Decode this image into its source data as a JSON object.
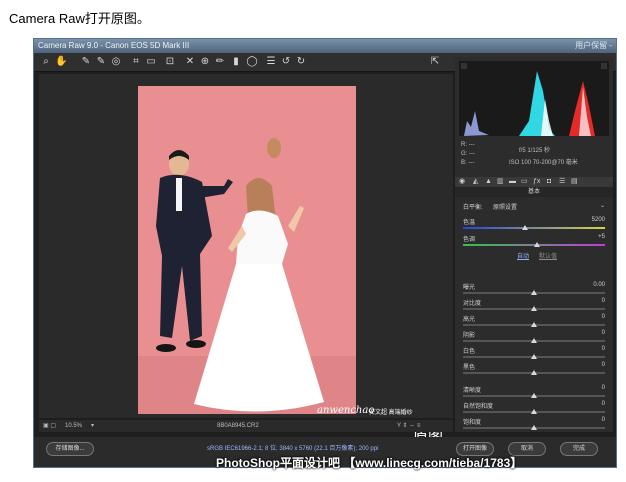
{
  "caption": "Camera Raw打开原图。",
  "window": {
    "title": "Camera Raw 9.0 - Canon EOS 5D Mark III",
    "title_right": "用户保留 -"
  },
  "toolbar": {
    "icons": [
      "zoom-icon",
      "hand-icon",
      "white-balance-icon",
      "color-sampler-icon",
      "target-adjust-icon",
      "crop-icon",
      "straighten-icon",
      "transform-icon",
      "spot-removal-icon",
      "red-eye-icon",
      "adjust-brush-icon",
      "graduated-filter-icon",
      "radial-filter-icon",
      "preferences-icon",
      "rotate-ccw-icon",
      "rotate-cw-icon",
      "fullscreen-icon"
    ]
  },
  "photo": {
    "watermark_script": "anwenchao",
    "watermark_cn": "安文超 高端婚纱",
    "watermark_label": "原图"
  },
  "bottombar": {
    "zoom": "10.5%",
    "filename": "8B0A8945.CR2"
  },
  "camera": {
    "r": "R: ---",
    "g": "G: ---",
    "b": "B: ---",
    "aperture": "f/5",
    "shutter": "1/125 秒",
    "iso": "ISO 100",
    "focal": "70-200@70 毫米"
  },
  "panel": {
    "title": "基本",
    "wb_label": "白平衡:",
    "wb_value": "原照设置",
    "temp": {
      "label": "色温",
      "value": "5200",
      "level": 0.44
    },
    "tint": {
      "label": "色调",
      "value": "+5",
      "level": 0.52
    },
    "auto": "自动",
    "default": "默认值",
    "sliders": [
      {
        "label": "曝光",
        "value": "0.00",
        "level": 0.5
      },
      {
        "label": "对比度",
        "value": "0",
        "level": 0.5
      },
      {
        "label": "高光",
        "value": "0",
        "level": 0.5
      },
      {
        "label": "阴影",
        "value": "0",
        "level": 0.5
      },
      {
        "label": "白色",
        "value": "0",
        "level": 0.5
      },
      {
        "label": "黑色",
        "value": "0",
        "level": 0.5
      },
      {
        "label": "清晰度",
        "value": "0",
        "level": 0.5
      },
      {
        "label": "自然饱和度",
        "value": "0",
        "level": 0.5
      },
      {
        "label": "饱和度",
        "value": "0",
        "level": 0.5
      }
    ]
  },
  "footer": {
    "save": "存储图像...",
    "info": "sRGB IEC61966-2.1; 8 位; 3840 x 5760 (22.1 百万像素); 200 ppi",
    "open": "打开图像",
    "cancel": "取消",
    "done": "完成"
  },
  "forum": "PhotoShop平面设计吧 【www.linecg.com/tieba/1783】",
  "colors": {
    "accent": "#5a6f86",
    "photo_bg": "#e88f91"
  }
}
